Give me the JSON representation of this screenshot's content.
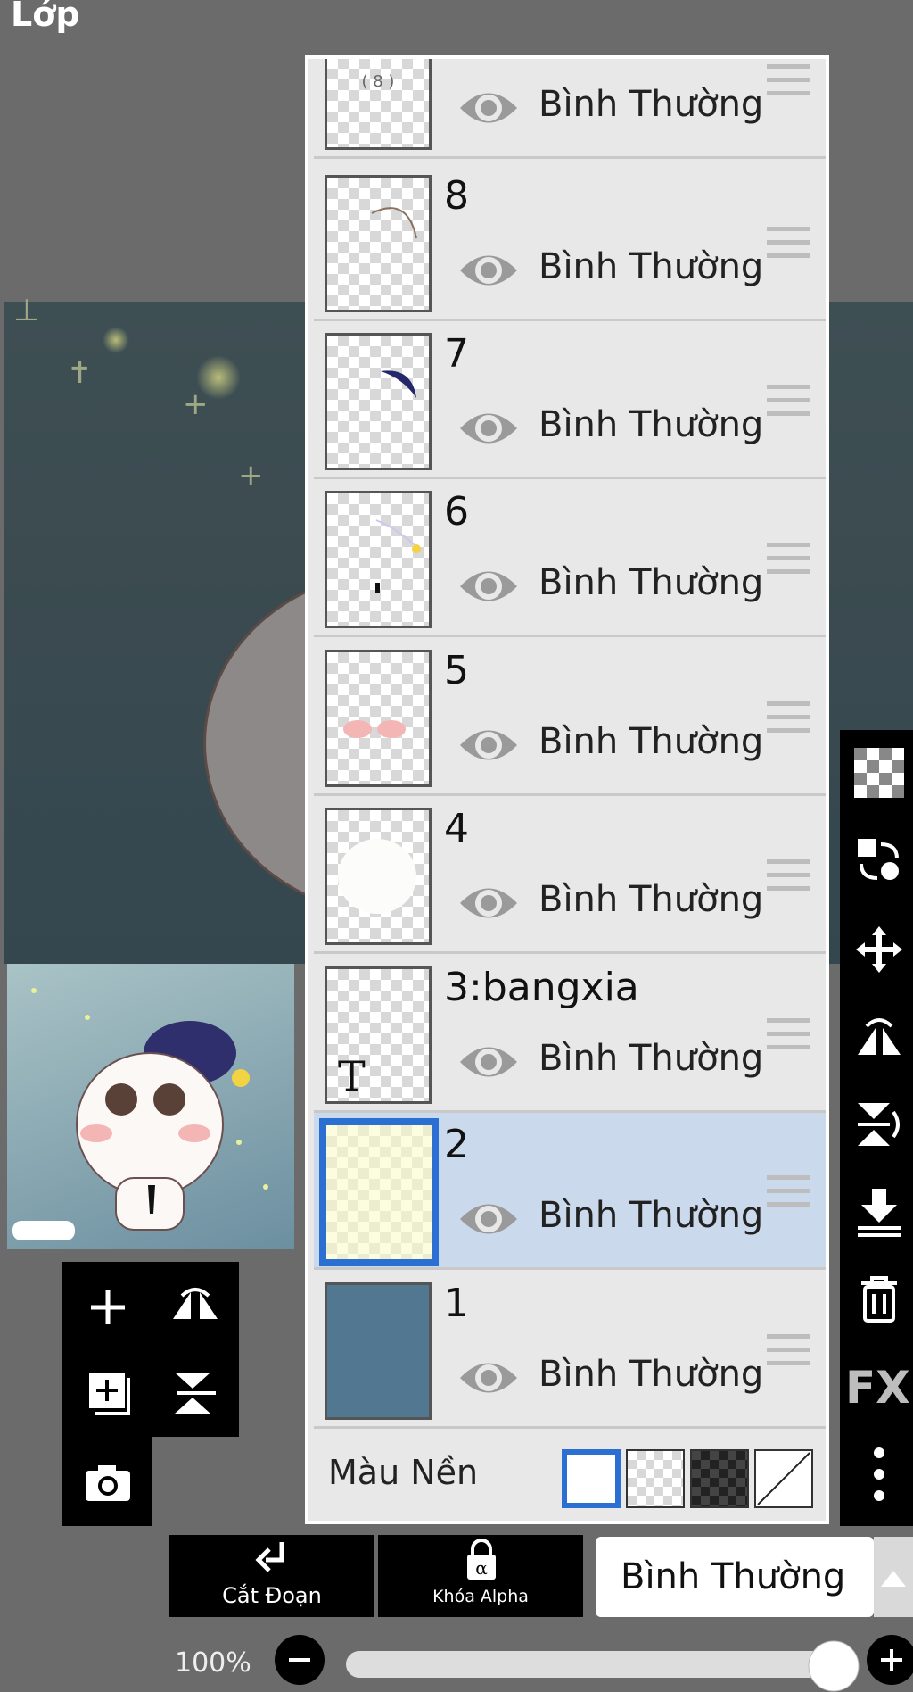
{
  "title": "Lớp",
  "layers": [
    {
      "name": "",
      "mode": "Bình Thường",
      "selected": false
    },
    {
      "name": "8",
      "mode": "Bình Thường",
      "selected": false
    },
    {
      "name": "7",
      "mode": "Bình Thường",
      "selected": false
    },
    {
      "name": "6",
      "mode": "Bình Thường",
      "selected": false
    },
    {
      "name": "5",
      "mode": "Bình Thường",
      "selected": false
    },
    {
      "name": "4",
      "mode": "Bình Thường",
      "selected": false
    },
    {
      "name": "3:bangxia",
      "mode": "Bình Thường",
      "selected": false
    },
    {
      "name": "2",
      "mode": "Bình Thường",
      "selected": true
    },
    {
      "name": "1",
      "mode": "Bình Thường",
      "selected": false
    }
  ],
  "background": {
    "label": "Màu Nền",
    "selected_swatch": "white"
  },
  "bottom": {
    "clip_label": "Cắt Đoạn",
    "alpha_lock_label": "Khóa Alpha",
    "blend_mode": "Bình Thường",
    "zoom": "100%"
  },
  "colors": {
    "accent": "#2a6fd1",
    "selected_row": "#cbd9ed",
    "layer1_fill": "#527891"
  },
  "right_tools": {
    "fx_label": "FX"
  },
  "icons": [
    "plus-icon",
    "add-layer-icon",
    "camera-icon",
    "flip-h-icon",
    "flip-v-icon",
    "checker-icon",
    "transfer-icon",
    "move-icon",
    "mirror-icon",
    "rotate-flip-icon",
    "merge-down-icon",
    "trash-icon",
    "more-icon",
    "eye-icon",
    "drag-handle-icon",
    "lock-icon",
    "clip-arrow-icon"
  ]
}
